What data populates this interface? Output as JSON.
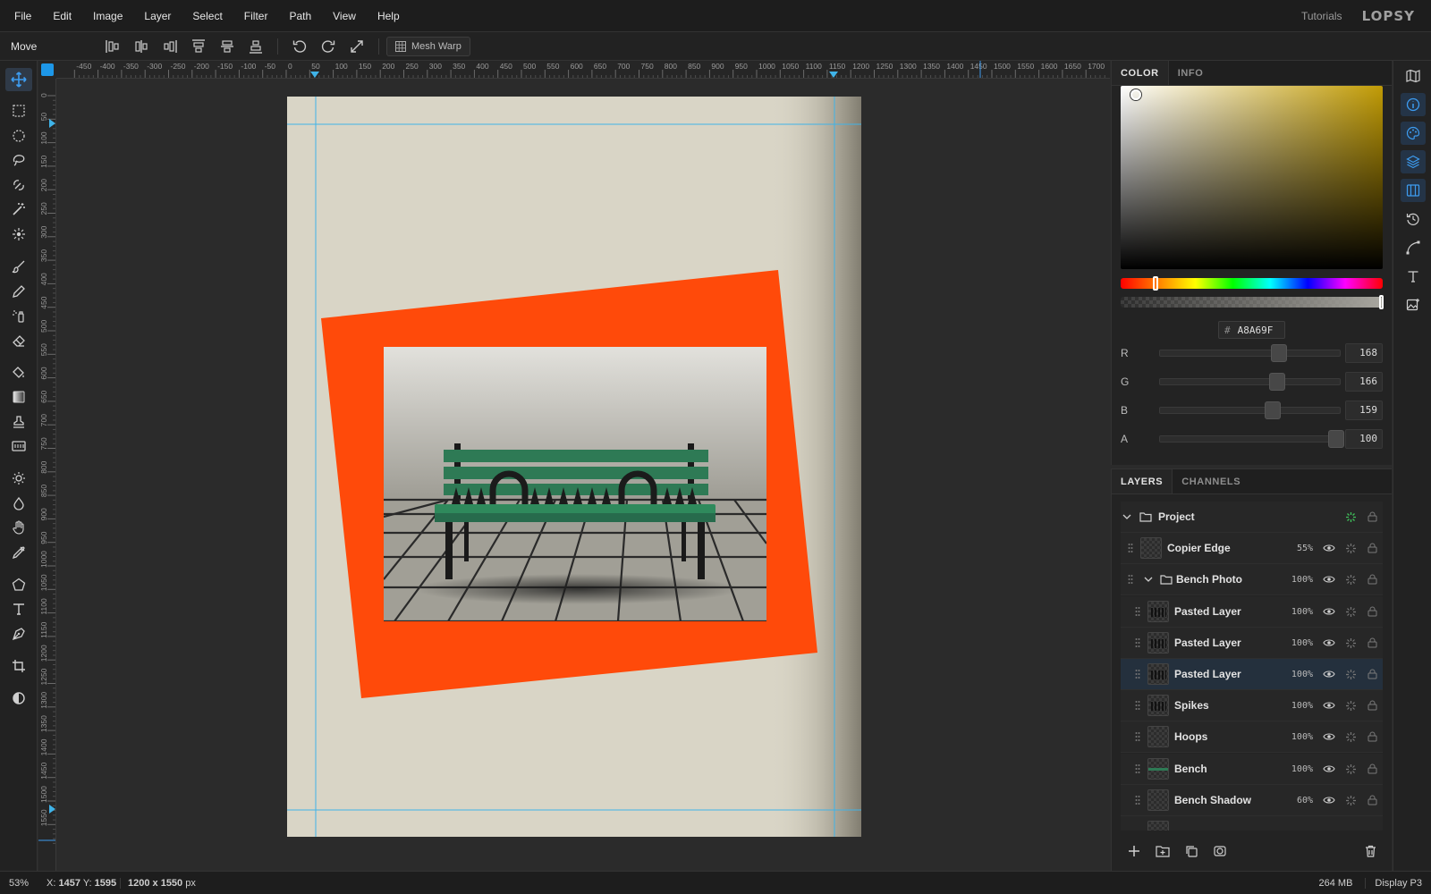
{
  "menu": {
    "items": [
      "File",
      "Edit",
      "Image",
      "Layer",
      "Select",
      "Filter",
      "Path",
      "View",
      "Help"
    ],
    "tutorials": "Tutorials",
    "logo": "LOPSY"
  },
  "options": {
    "tool_name": "Move",
    "mesh_warp": "Mesh Warp"
  },
  "icons": {
    "toolbar": [
      "move-icon",
      "rect-select-icon",
      "ellipse-select-icon",
      "lasso-icon",
      "magnetic-lasso-icon",
      "magic-wand-icon",
      "quick-select-icon",
      "brush-icon",
      "pencil-icon",
      "spray-icon",
      "eraser-icon",
      "bucket-icon",
      "gradient-icon",
      "stamp-icon",
      "pattern-icon",
      "dodge-icon",
      "blur-icon",
      "hand-icon",
      "eyedropper-icon",
      "shape-icon",
      "text-icon",
      "pen-icon",
      "crop-icon",
      "contrast-icon"
    ],
    "right_strip": [
      "map-icon",
      "info-icon",
      "palette-icon",
      "layers-icon",
      "columns-icon",
      "history-icon",
      "path-icon",
      "text-icon",
      "image-icon"
    ]
  },
  "rulers": {
    "h_ticks": [
      "-450",
      "-400",
      "-350",
      "-300",
      "-250",
      "-200",
      "-150",
      "-100",
      "-50",
      "0",
      "50",
      "100",
      "150",
      "200",
      "250",
      "300",
      "350",
      "400",
      "450",
      "500",
      "550",
      "600",
      "650",
      "700",
      "750",
      "800",
      "850",
      "900",
      "950",
      "1000",
      "1050",
      "1100",
      "1150",
      "1200",
      "1250",
      "1300",
      "1350",
      "1400",
      "1450",
      "1500",
      "1550",
      "1600",
      "1650",
      "1700"
    ],
    "v_ticks": [
      "0",
      "50",
      "100",
      "150",
      "200",
      "250",
      "300",
      "350",
      "400",
      "450",
      "500",
      "550",
      "600",
      "650",
      "700",
      "750",
      "800",
      "850",
      "900",
      "950",
      "1000",
      "1050",
      "1100",
      "1150",
      "1200",
      "1250",
      "1300",
      "1350",
      "1400",
      "1450",
      "1500",
      "1550"
    ]
  },
  "color_panel": {
    "tabs": [
      "COLOR",
      "INFO"
    ],
    "hex": "A8A69F",
    "hash": "#",
    "channels": [
      {
        "label": "R",
        "value": "168",
        "fraction": 0.659
      },
      {
        "label": "G",
        "value": "166",
        "fraction": 0.651
      },
      {
        "label": "B",
        "value": "159",
        "fraction": 0.624
      },
      {
        "label": "A",
        "value": "100",
        "fraction": 1.0
      }
    ],
    "hue_color": "#c19b05"
  },
  "layers_panel": {
    "tabs": [
      "LAYERS",
      "CHANNELS"
    ],
    "layers": [
      {
        "name": "Project",
        "opacity": "",
        "kind": "group-root"
      },
      {
        "name": "Copier Edge",
        "opacity": "55%",
        "kind": "layer"
      },
      {
        "name": "Bench Photo",
        "opacity": "100%",
        "kind": "group"
      },
      {
        "name": "Pasted Layer",
        "opacity": "100%",
        "kind": "child"
      },
      {
        "name": "Pasted Layer",
        "opacity": "100%",
        "kind": "child"
      },
      {
        "name": "Pasted Layer",
        "opacity": "100%",
        "kind": "child-selected"
      },
      {
        "name": "Spikes",
        "opacity": "100%",
        "kind": "child"
      },
      {
        "name": "Hoops",
        "opacity": "100%",
        "kind": "child"
      },
      {
        "name": "Bench",
        "opacity": "100%",
        "kind": "child"
      },
      {
        "name": "Bench Shadow",
        "opacity": "60%",
        "kind": "child"
      }
    ]
  },
  "status": {
    "zoom": "53%",
    "x_label": "X:",
    "x": "1457",
    "y_label": "Y:",
    "y": "1595",
    "dims": "1200 x 1550",
    "dims_unit": "px",
    "memory": "264 MB",
    "profile": "Display P3"
  },
  "colors": {
    "accent": "#1d97e8",
    "frame_orange": "#ff4a0a",
    "paper": "#d9d5c6",
    "bench_green": "#2e7a55"
  }
}
